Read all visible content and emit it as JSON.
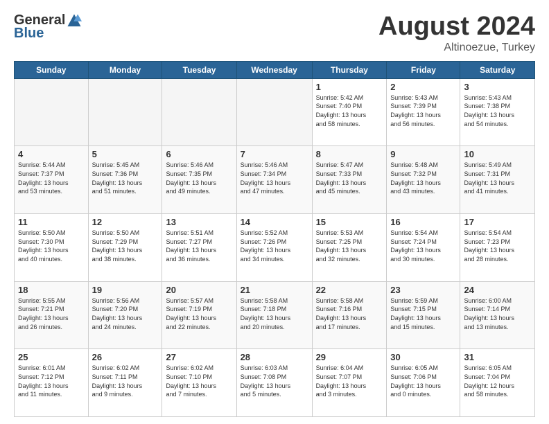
{
  "header": {
    "logo_general": "General",
    "logo_blue": "Blue",
    "month_title": "August 2024",
    "location": "Altinoezue, Turkey"
  },
  "days_of_week": [
    "Sunday",
    "Monday",
    "Tuesday",
    "Wednesday",
    "Thursday",
    "Friday",
    "Saturday"
  ],
  "weeks": [
    [
      {
        "day": "",
        "info": ""
      },
      {
        "day": "",
        "info": ""
      },
      {
        "day": "",
        "info": ""
      },
      {
        "day": "",
        "info": ""
      },
      {
        "day": "1",
        "info": "Sunrise: 5:42 AM\nSunset: 7:40 PM\nDaylight: 13 hours\nand 58 minutes."
      },
      {
        "day": "2",
        "info": "Sunrise: 5:43 AM\nSunset: 7:39 PM\nDaylight: 13 hours\nand 56 minutes."
      },
      {
        "day": "3",
        "info": "Sunrise: 5:43 AM\nSunset: 7:38 PM\nDaylight: 13 hours\nand 54 minutes."
      }
    ],
    [
      {
        "day": "4",
        "info": "Sunrise: 5:44 AM\nSunset: 7:37 PM\nDaylight: 13 hours\nand 53 minutes."
      },
      {
        "day": "5",
        "info": "Sunrise: 5:45 AM\nSunset: 7:36 PM\nDaylight: 13 hours\nand 51 minutes."
      },
      {
        "day": "6",
        "info": "Sunrise: 5:46 AM\nSunset: 7:35 PM\nDaylight: 13 hours\nand 49 minutes."
      },
      {
        "day": "7",
        "info": "Sunrise: 5:46 AM\nSunset: 7:34 PM\nDaylight: 13 hours\nand 47 minutes."
      },
      {
        "day": "8",
        "info": "Sunrise: 5:47 AM\nSunset: 7:33 PM\nDaylight: 13 hours\nand 45 minutes."
      },
      {
        "day": "9",
        "info": "Sunrise: 5:48 AM\nSunset: 7:32 PM\nDaylight: 13 hours\nand 43 minutes."
      },
      {
        "day": "10",
        "info": "Sunrise: 5:49 AM\nSunset: 7:31 PM\nDaylight: 13 hours\nand 41 minutes."
      }
    ],
    [
      {
        "day": "11",
        "info": "Sunrise: 5:50 AM\nSunset: 7:30 PM\nDaylight: 13 hours\nand 40 minutes."
      },
      {
        "day": "12",
        "info": "Sunrise: 5:50 AM\nSunset: 7:29 PM\nDaylight: 13 hours\nand 38 minutes."
      },
      {
        "day": "13",
        "info": "Sunrise: 5:51 AM\nSunset: 7:27 PM\nDaylight: 13 hours\nand 36 minutes."
      },
      {
        "day": "14",
        "info": "Sunrise: 5:52 AM\nSunset: 7:26 PM\nDaylight: 13 hours\nand 34 minutes."
      },
      {
        "day": "15",
        "info": "Sunrise: 5:53 AM\nSunset: 7:25 PM\nDaylight: 13 hours\nand 32 minutes."
      },
      {
        "day": "16",
        "info": "Sunrise: 5:54 AM\nSunset: 7:24 PM\nDaylight: 13 hours\nand 30 minutes."
      },
      {
        "day": "17",
        "info": "Sunrise: 5:54 AM\nSunset: 7:23 PM\nDaylight: 13 hours\nand 28 minutes."
      }
    ],
    [
      {
        "day": "18",
        "info": "Sunrise: 5:55 AM\nSunset: 7:21 PM\nDaylight: 13 hours\nand 26 minutes."
      },
      {
        "day": "19",
        "info": "Sunrise: 5:56 AM\nSunset: 7:20 PM\nDaylight: 13 hours\nand 24 minutes."
      },
      {
        "day": "20",
        "info": "Sunrise: 5:57 AM\nSunset: 7:19 PM\nDaylight: 13 hours\nand 22 minutes."
      },
      {
        "day": "21",
        "info": "Sunrise: 5:58 AM\nSunset: 7:18 PM\nDaylight: 13 hours\nand 20 minutes."
      },
      {
        "day": "22",
        "info": "Sunrise: 5:58 AM\nSunset: 7:16 PM\nDaylight: 13 hours\nand 17 minutes."
      },
      {
        "day": "23",
        "info": "Sunrise: 5:59 AM\nSunset: 7:15 PM\nDaylight: 13 hours\nand 15 minutes."
      },
      {
        "day": "24",
        "info": "Sunrise: 6:00 AM\nSunset: 7:14 PM\nDaylight: 13 hours\nand 13 minutes."
      }
    ],
    [
      {
        "day": "25",
        "info": "Sunrise: 6:01 AM\nSunset: 7:12 PM\nDaylight: 13 hours\nand 11 minutes."
      },
      {
        "day": "26",
        "info": "Sunrise: 6:02 AM\nSunset: 7:11 PM\nDaylight: 13 hours\nand 9 minutes."
      },
      {
        "day": "27",
        "info": "Sunrise: 6:02 AM\nSunset: 7:10 PM\nDaylight: 13 hours\nand 7 minutes."
      },
      {
        "day": "28",
        "info": "Sunrise: 6:03 AM\nSunset: 7:08 PM\nDaylight: 13 hours\nand 5 minutes."
      },
      {
        "day": "29",
        "info": "Sunrise: 6:04 AM\nSunset: 7:07 PM\nDaylight: 13 hours\nand 3 minutes."
      },
      {
        "day": "30",
        "info": "Sunrise: 6:05 AM\nSunset: 7:06 PM\nDaylight: 13 hours\nand 0 minutes."
      },
      {
        "day": "31",
        "info": "Sunrise: 6:05 AM\nSunset: 7:04 PM\nDaylight: 12 hours\nand 58 minutes."
      }
    ]
  ]
}
